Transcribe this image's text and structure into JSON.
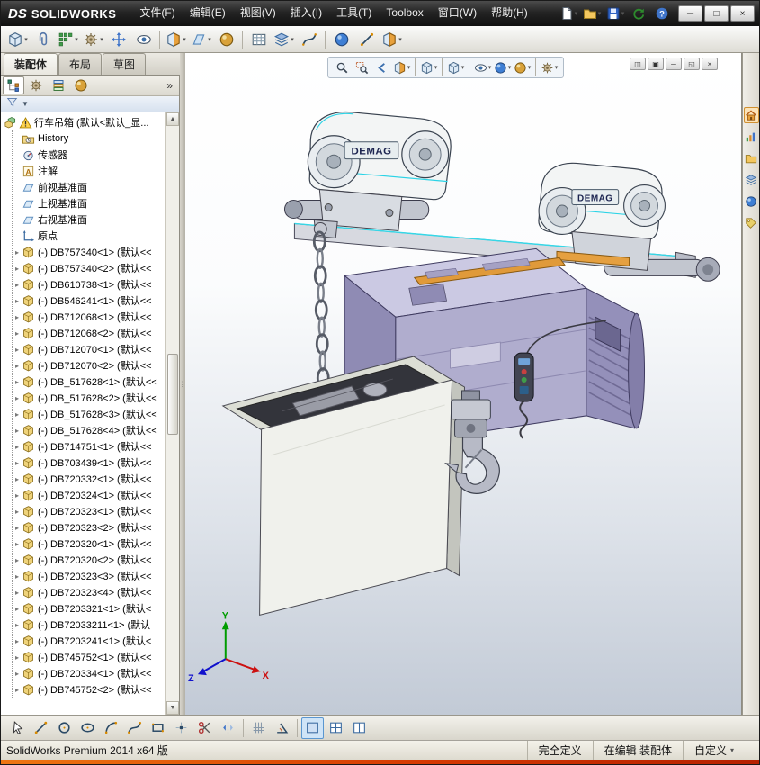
{
  "titlebar": {
    "logo_mark": "DS",
    "logo_text": "SOLIDWORKS",
    "menus": [
      {
        "id": "file",
        "label": "文件(F)"
      },
      {
        "id": "edit",
        "label": "编辑(E)"
      },
      {
        "id": "view",
        "label": "视图(V)"
      },
      {
        "id": "insert",
        "label": "插入(I)"
      },
      {
        "id": "tools",
        "label": "工具(T)"
      },
      {
        "id": "toolbox",
        "label": "Toolbox"
      },
      {
        "id": "window",
        "label": "窗口(W)"
      },
      {
        "id": "help",
        "label": "帮助(H)"
      }
    ],
    "qat_icons": [
      "new-document",
      "open-document",
      "save",
      "rebuild",
      "help"
    ],
    "window_buttons": [
      {
        "name": "minimize",
        "glyph": "─"
      },
      {
        "name": "maximize",
        "glyph": "□"
      },
      {
        "name": "close",
        "glyph": "×"
      }
    ]
  },
  "toolbar": {
    "icons": [
      "insert-component",
      "mate",
      "linear-component-pattern",
      "smart-fasteners",
      "move-component",
      "show-hidden-components",
      "|",
      "assembly-features",
      "reference-geometry",
      "new-motion-study",
      "|",
      "bill-of-materials",
      "exploded-view",
      "explode-line-sketch",
      "|",
      "interference-detection",
      "measure",
      "section-view"
    ]
  },
  "command_tabs": [
    {
      "id": "assembly",
      "label": "装配体",
      "active": true
    },
    {
      "id": "layout",
      "label": "布局",
      "active": false
    },
    {
      "id": "sketch",
      "label": "草图",
      "active": false
    }
  ],
  "panel": {
    "tab_icons": [
      "feature-manager-tree",
      "property-manager",
      "configuration-manager",
      "display-manager"
    ],
    "overflow_glyph": "»",
    "filter_icons": [
      "filter"
    ],
    "filter_drop_glyph": "▼"
  },
  "feature_tree": {
    "root_label": "行车吊箱 (默认<默认_显...",
    "features": [
      {
        "type": "history",
        "label": "History"
      },
      {
        "type": "sensors",
        "label": "传感器"
      },
      {
        "type": "annotations",
        "label": "注解"
      },
      {
        "type": "plane",
        "label": "前视基准面"
      },
      {
        "type": "plane",
        "label": "上视基准面"
      },
      {
        "type": "plane",
        "label": "右视基准面"
      },
      {
        "type": "origin",
        "label": "原点"
      }
    ],
    "parts": [
      "(-) DB757340<1> (默认<<",
      "(-) DB757340<2> (默认<<",
      "(-) DB610738<1> (默认<<",
      "(-) DB546241<1> (默认<<",
      "(-) DB712068<1> (默认<<",
      "(-) DB712068<2> (默认<<",
      "(-) DB712070<1> (默认<<",
      "(-) DB712070<2> (默认<<",
      "(-) DB_517628<1> (默认<<",
      "(-) DB_517628<2> (默认<<",
      "(-) DB_517628<3> (默认<<",
      "(-) DB_517628<4> (默认<<",
      "(-) DB714751<1> (默认<<",
      "(-) DB703439<1> (默认<<",
      "(-) DB720332<1> (默认<<",
      "(-) DB720324<1> (默认<<",
      "(-) DB720323<1> (默认<<",
      "(-) DB720323<2> (默认<<",
      "(-) DB720320<1> (默认<<",
      "(-) DB720320<2> (默认<<",
      "(-) DB720323<3> (默认<<",
      "(-) DB720323<4> (默认<<",
      "(-) DB7203321<1> (默认<",
      "(-) DB72033211<1> (默认",
      "(-) DB7203241<1> (默认<",
      "(-) DB745752<1> (默认<<",
      "(-) DB720334<1> (默认<<",
      "(-) DB745752<2> (默认<<"
    ]
  },
  "viewport": {
    "hud_icons": [
      "zoom-fit",
      "zoom-area",
      "previous-view",
      "section-view",
      "|",
      "view-orientation",
      "|",
      "display-style",
      "|",
      "hide-show-items",
      "edit-appearance",
      "apply-scene",
      "|",
      "view-settings"
    ],
    "window_buttons": [
      {
        "name": "viewport-split",
        "glyph": "◫"
      },
      {
        "name": "viewport-tile",
        "glyph": "▣"
      },
      {
        "name": "minimize-document",
        "glyph": "─"
      },
      {
        "name": "restore-document",
        "glyph": "◱"
      },
      {
        "name": "close-document",
        "glyph": "×"
      }
    ],
    "model": {
      "brand": "DEMAG",
      "triad": {
        "x": "X",
        "y": "Y",
        "z": "Z"
      }
    }
  },
  "taskpane": {
    "icons": [
      "home",
      "design-library",
      "file-explorer",
      "view-palette",
      "appearances-scenes",
      "custom-properties"
    ]
  },
  "sketchbar": {
    "icons": [
      "select",
      "line",
      "circle",
      "ellipse",
      "arc",
      "spline",
      "corner-rectangle",
      "point",
      "trim-entities",
      "mirror-entities",
      "|",
      "grid-snap",
      "angle-snap",
      "|",
      "single-viewport",
      "four-viewport",
      "two-viewport"
    ]
  },
  "statusbar": {
    "product": "SolidWorks Premium 2014 x64 版",
    "define_state": "完全定义",
    "edit_state": "在编辑 装配体",
    "custom": "自定义",
    "custom_drop_glyph": "▾"
  }
}
